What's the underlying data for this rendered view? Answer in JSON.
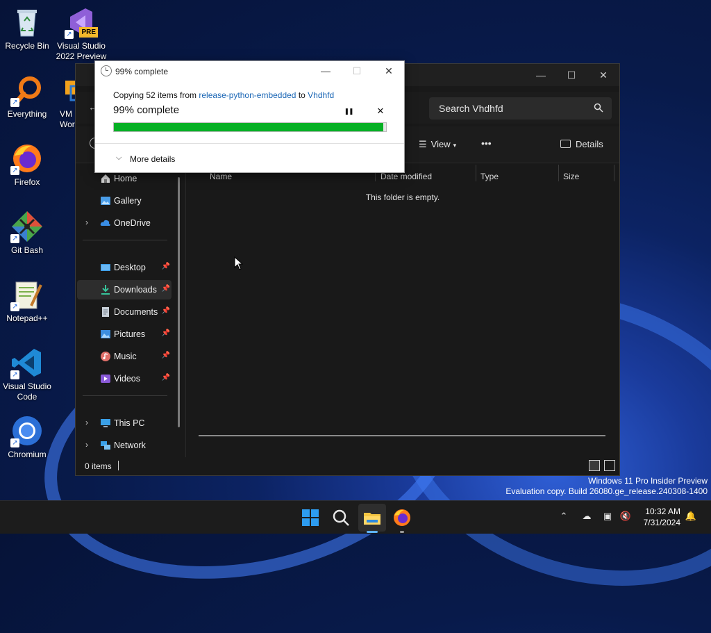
{
  "desktop": {
    "icons": [
      {
        "label": "Recycle Bin"
      },
      {
        "label": "Visual Studio 2022 Preview",
        "badge": "PRE"
      },
      {
        "label": "Everything"
      },
      {
        "label": "VM Wor",
        "partial": true
      },
      {
        "label": "Firefox"
      },
      {
        "label": "Git Bash"
      },
      {
        "label": "Notepad++"
      },
      {
        "label": "Visual Studio Code"
      },
      {
        "label": "Chromium"
      }
    ],
    "watermark_line1": "Windows 11 Pro Insider Preview",
    "watermark_line2": "Evaluation copy. Build 26080.ge_release.240308-1400"
  },
  "explorer": {
    "search_placeholder": "Search Vhdhfd",
    "toolbar": {
      "view_label": "View",
      "more_label": "•••",
      "details_label": "Details"
    },
    "sidebar": {
      "items": [
        {
          "label": "Home",
          "icon": "home-icon"
        },
        {
          "label": "Gallery",
          "icon": "gallery-icon"
        },
        {
          "label": "OneDrive",
          "icon": "cloud-icon",
          "expandable": true
        },
        {
          "label": "Desktop",
          "icon": "desktop-icon",
          "pinned": true
        },
        {
          "label": "Downloads",
          "icon": "download-icon",
          "pinned": true,
          "selected": true
        },
        {
          "label": "Documents",
          "icon": "document-icon",
          "pinned": true
        },
        {
          "label": "Pictures",
          "icon": "pictures-icon",
          "pinned": true
        },
        {
          "label": "Music",
          "icon": "music-icon",
          "pinned": true
        },
        {
          "label": "Videos",
          "icon": "videos-icon",
          "pinned": true
        },
        {
          "label": "This PC",
          "icon": "pc-icon",
          "expandable": true
        },
        {
          "label": "Network",
          "icon": "network-icon",
          "expandable": true
        }
      ]
    },
    "columns": [
      "Name",
      "Date modified",
      "Type",
      "Size"
    ],
    "empty_message": "This folder is empty.",
    "status_count": "0 items"
  },
  "copy_dialog": {
    "title": "99% complete",
    "copy_prefix": "Copying 52 items from ",
    "source": "release-python-embedded",
    "copy_mid": " to ",
    "destination": "Vhdhfd",
    "percent_text": "99% complete",
    "progress": 0.99,
    "pause_symbol": "❚❚",
    "cancel_symbol": "✕",
    "more_details": "More details",
    "progress_color": "#06b025"
  },
  "taskbar": {
    "time": "10:32 AM",
    "date": "7/31/2024"
  }
}
